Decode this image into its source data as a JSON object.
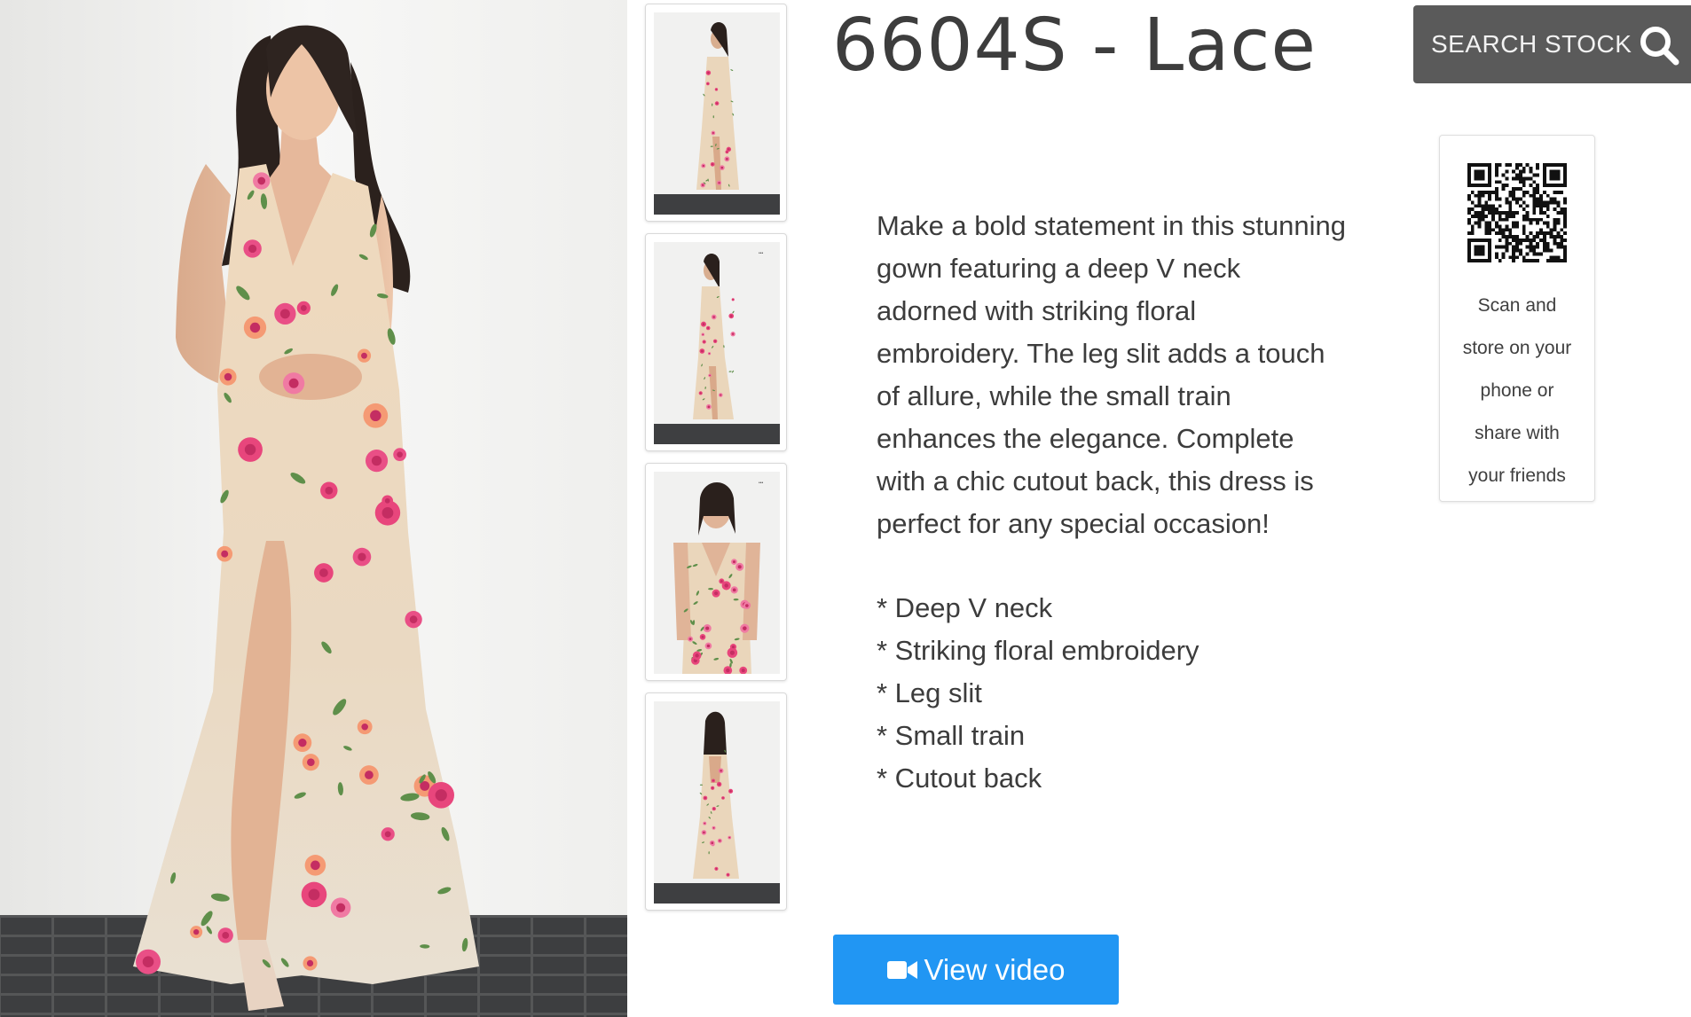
{
  "product": {
    "title": "6604S - Lace",
    "main_image_alt": "Model wearing nude lace gown with pink floral embroidery",
    "thumbnails": [
      {
        "alt": "Front view full length"
      },
      {
        "alt": "Side view full length"
      },
      {
        "alt": "Close-up front view"
      },
      {
        "alt": "Back view full length"
      }
    ],
    "description": "Make a bold statement in this stunning gown featuring a deep V neck adorned with striking floral embroidery. The leg slit adds a touch of allure, while the small train enhances the elegance. Complete with a chic cutout back, this dress is perfect for any special occasion!",
    "features": [
      "* Deep V neck",
      "* Striking floral embroidery",
      "* Leg slit",
      "* Small train",
      "* Cutout back"
    ]
  },
  "search": {
    "label": "SEARCH STOCK",
    "icon": "search-icon"
  },
  "qr": {
    "caption_lines": [
      "Scan and",
      "store on your",
      "phone or",
      "share with",
      "your friends"
    ]
  },
  "video": {
    "label": "View video",
    "icon": "video-camera-icon"
  },
  "colors": {
    "title_text": "#3d3d3d",
    "search_bg": "#5a5a5a",
    "video_button_bg": "#2196f3",
    "dress_base": "#eddcc0",
    "flower_pink": "#e8467c",
    "leaf_green": "#5f8f4a"
  }
}
